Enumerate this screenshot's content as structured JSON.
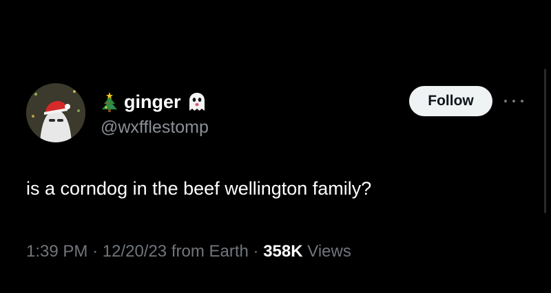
{
  "author": {
    "display_name": "ginger",
    "handle": "@wxfflestomp",
    "name_prefix_icon": "christmas-tree-icon",
    "name_suffix_icon": "ghost-icon"
  },
  "follow_button": {
    "label": "Follow"
  },
  "more_menu": {
    "icon": "more-horizontal-icon"
  },
  "tweet": {
    "text": "is a corndog in the beef wellington family?"
  },
  "meta": {
    "time": "1:39 PM",
    "separator": "·",
    "date": "12/20/23 from Earth",
    "views_count": "358K",
    "views_label": "Views"
  },
  "colors": {
    "background": "#000000",
    "primary_text": "#ffffff",
    "secondary_text": "#71767b",
    "follow_button_bg": "#eff3f4",
    "follow_button_text": "#0f1419"
  }
}
